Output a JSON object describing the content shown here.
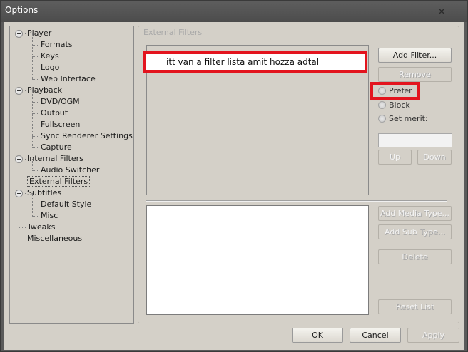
{
  "window": {
    "title": "Options"
  },
  "tree": {
    "items": [
      {
        "label": "Player",
        "level": 0,
        "toggle": true
      },
      {
        "label": "Formats",
        "level": 1
      },
      {
        "label": "Keys",
        "level": 1
      },
      {
        "label": "Logo",
        "level": 1
      },
      {
        "label": "Web Interface",
        "level": 1
      },
      {
        "label": "Playback",
        "level": 0,
        "toggle": true
      },
      {
        "label": "DVD/OGM",
        "level": 1
      },
      {
        "label": "Output",
        "level": 1
      },
      {
        "label": "Fullscreen",
        "level": 1
      },
      {
        "label": "Sync Renderer Settings",
        "level": 1
      },
      {
        "label": "Capture",
        "level": 1
      },
      {
        "label": "Internal Filters",
        "level": 0,
        "toggle": true
      },
      {
        "label": "Audio Switcher",
        "level": 1
      },
      {
        "label": "External Filters",
        "level": 0,
        "selected": true
      },
      {
        "label": "Subtitles",
        "level": 0,
        "toggle": true
      },
      {
        "label": "Default Style",
        "level": 1
      },
      {
        "label": "Misc",
        "level": 1
      },
      {
        "label": "Tweaks",
        "level": 0
      },
      {
        "label": "Miscellaneous",
        "level": 0
      }
    ]
  },
  "external_filters": {
    "group_title": "External Filters",
    "annotation": "itt van a filter lista amit hozza adtal",
    "add_filter": "Add Filter...",
    "remove": "Remove",
    "merit_options": [
      "Prefer",
      "Block",
      "Set merit:"
    ],
    "up": "Up",
    "down": "Down",
    "add_media_type": "Add Media Type...",
    "add_sub_type": "Add Sub Type...",
    "delete": "Delete",
    "reset_list": "Reset List"
  },
  "dialog": {
    "ok": "OK",
    "cancel": "Cancel",
    "apply": "Apply"
  },
  "colors": {
    "annotation_red": "#e3141e"
  }
}
